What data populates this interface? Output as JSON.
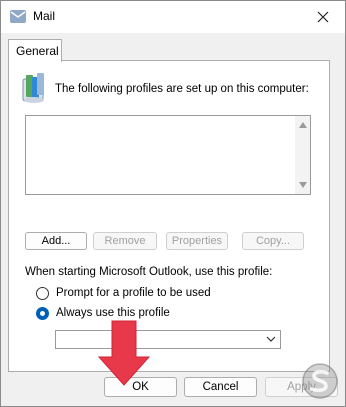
{
  "window": {
    "title": "Mail"
  },
  "tabs": [
    {
      "label": "General"
    }
  ],
  "intro_text": "The following profiles are set up on this computer:",
  "profile_buttons": {
    "add": "Add...",
    "remove": "Remove",
    "properties": "Properties",
    "copy": "Copy..."
  },
  "startup": {
    "label": "When starting Microsoft Outlook, use this profile:",
    "options": [
      {
        "label": "Prompt for a profile to be used",
        "selected": false
      },
      {
        "label": "Always use this profile",
        "selected": true
      }
    ],
    "profile_select_value": ""
  },
  "footer_buttons": {
    "ok": "OK",
    "cancel": "Cancel",
    "apply": "Apply"
  },
  "colors": {
    "accent": "#005fb8",
    "arrow": "#e8394b"
  },
  "icons": [
    "mail-app-icon",
    "close-icon",
    "profiles-icon",
    "scroll-up-icon",
    "scroll-down-icon",
    "dropdown-arrow-icon",
    "red-arrow-icon",
    "watermark-logo"
  ]
}
